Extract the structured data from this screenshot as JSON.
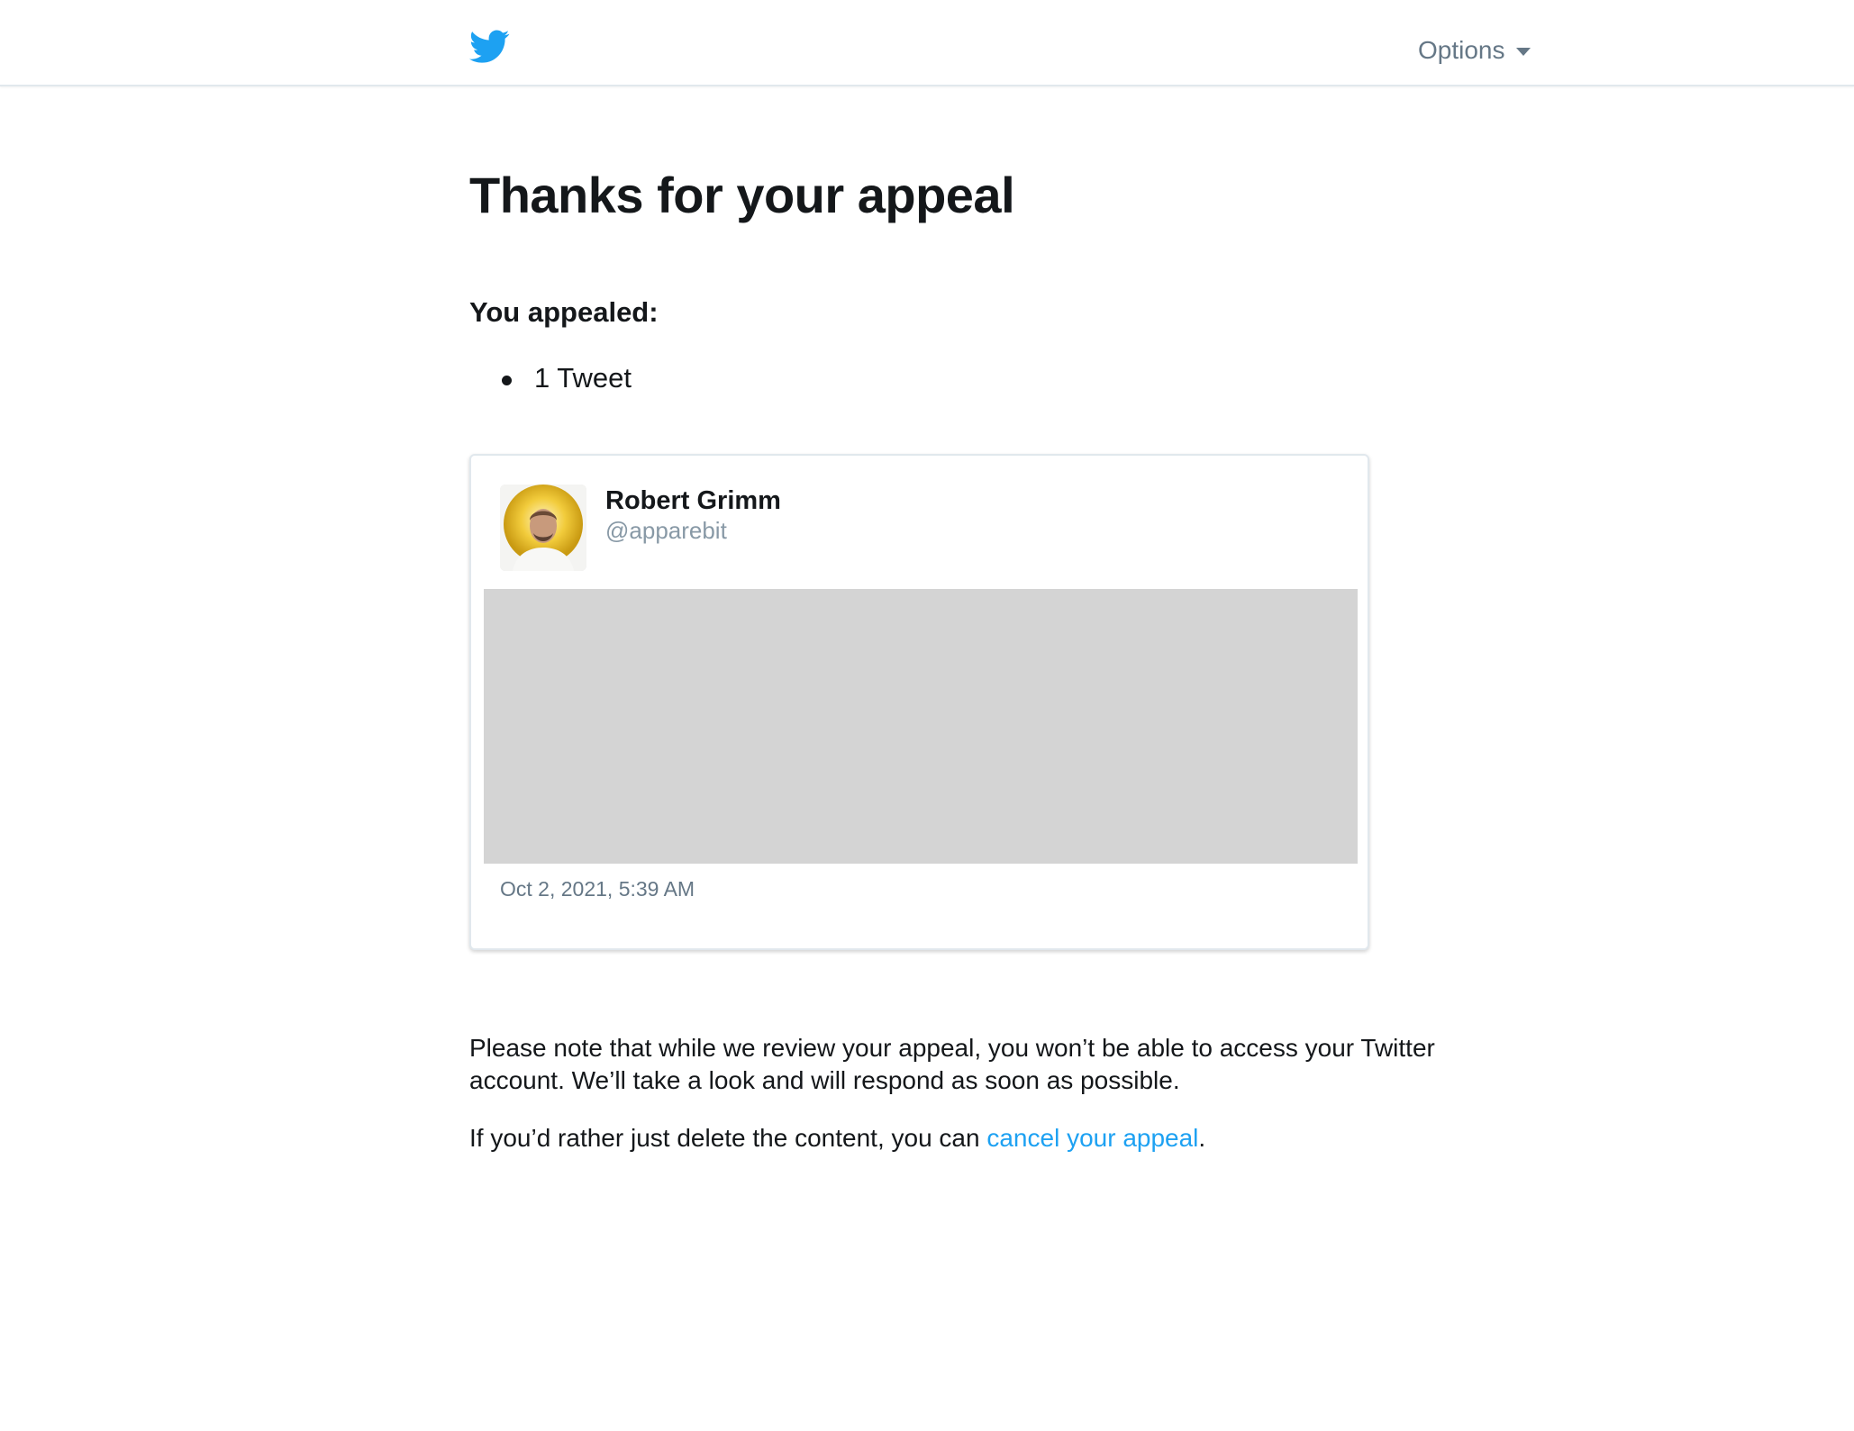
{
  "header": {
    "logo_icon": "twitter-bird-icon",
    "options_label": "Options",
    "options_icon": "caret-down-icon",
    "brand_color": "#1da1f2"
  },
  "main": {
    "title": "Thanks for your appeal",
    "appealed_label": "You appealed:",
    "appealed_items": [
      "1 Tweet"
    ]
  },
  "tweet": {
    "author_name": "Robert Grimm",
    "author_handle": "@apparebit",
    "timestamp": "Oct 2, 2021, 5:39 AM"
  },
  "note": {
    "text": "Please note that while we review your appeal, you won’t be able to access your Twitter account. We’ll take a look and will respond as soon as possible.",
    "cancel_prefix": "If you’d rather just delete the content, you can ",
    "cancel_link": "cancel your appeal",
    "cancel_suffix": "."
  }
}
